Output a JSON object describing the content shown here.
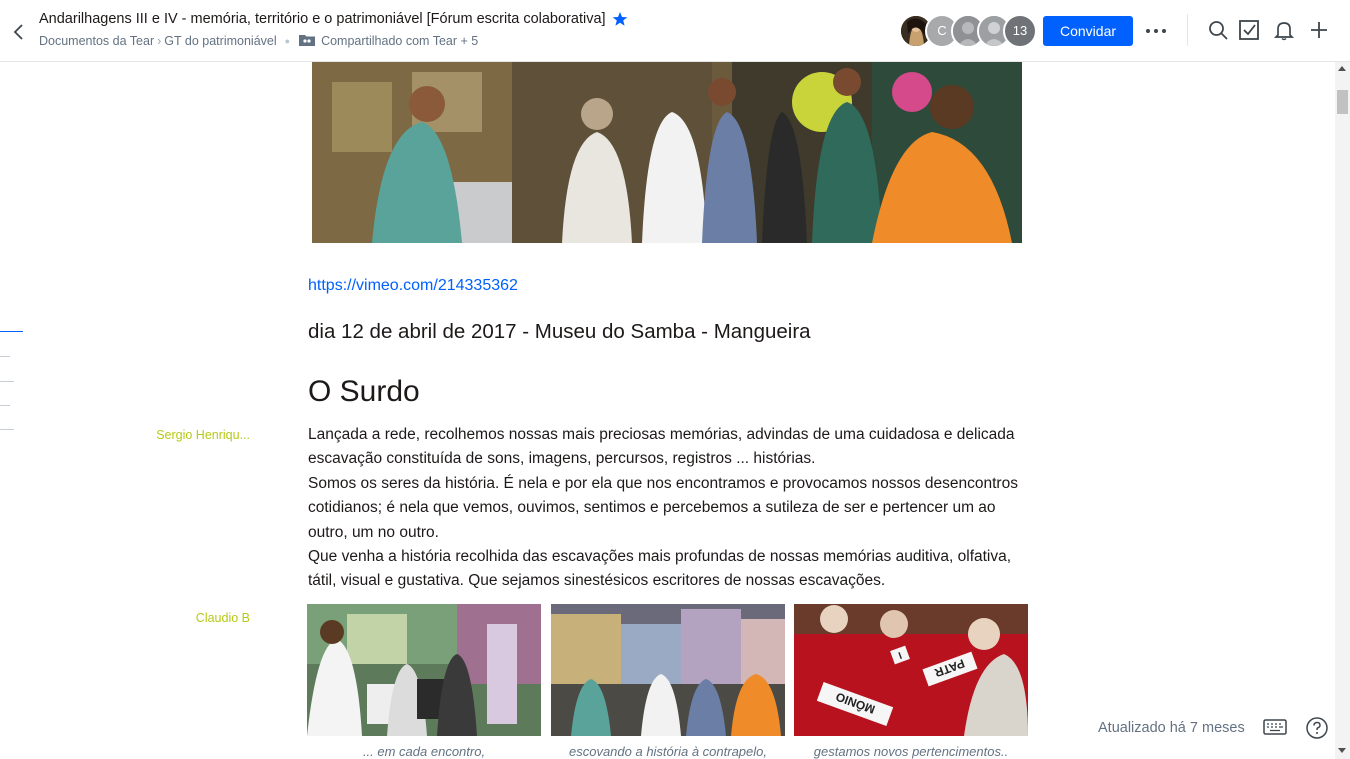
{
  "header": {
    "title": "Andarilhagens III e IV - memória, território e o patrimoniável [Fórum escrita colaborativa]",
    "breadcrumb": [
      "Documentos da Tear",
      "GT do patrimoniável"
    ],
    "breadcrumb_sep": "›",
    "shared_text": "Compartilhado com Tear + 5",
    "avatars": [
      {
        "label": "",
        "color": "#3a2e22"
      },
      {
        "label": "C",
        "color": "#a7a9ab"
      },
      {
        "label": "",
        "color": "#8f9194"
      },
      {
        "label": "",
        "color": "#9da0a3"
      },
      {
        "label": "13",
        "color": "#6f7378"
      }
    ],
    "invite_label": "Convidar",
    "star_color": "#0061fe"
  },
  "document": {
    "link": "https://vimeo.com/214335362",
    "date_line": "dia 12 de abril de 2017 - Museu do Samba - Mangueira",
    "heading": "O Surdo",
    "paragraph": [
      "Lançada a rede, recolhemos nossas mais preciosas memórias, advindas de uma cuidadosa e delicada escavação constituída de sons, imagens, percursos, registros ... histórias.",
      "Somos os seres da história. É nela e por ela que nos encontramos e provocamos nossos desencontros cotidianos; é nela que vemos, ouvimos, sentimos e percebemos a sutileza de ser e pertencer um ao outro, um no outro.",
      "Que venha a história recolhida das escavações mais profundas de nossas memórias auditiva, olfativa, tátil, visual e gustativa. Que sejamos sinestésicos escritores de nossas escavações."
    ],
    "captions": [
      "... em cada encontro,",
      "escovando a história à contrapelo,",
      "gestamos novos pertencimentos.."
    ],
    "photo_words": [
      "I",
      "PATR",
      "MÔNIO"
    ]
  },
  "comments": {
    "author_1": "Sergio Henriqu...",
    "author_2": "Claudio B",
    "author_color": "#b7c918"
  },
  "footer": {
    "updated": "Atualizado há 7 meses"
  },
  "colors": {
    "accent": "#0061fe",
    "link": "#0061fe",
    "secondary_text": "#637282"
  }
}
